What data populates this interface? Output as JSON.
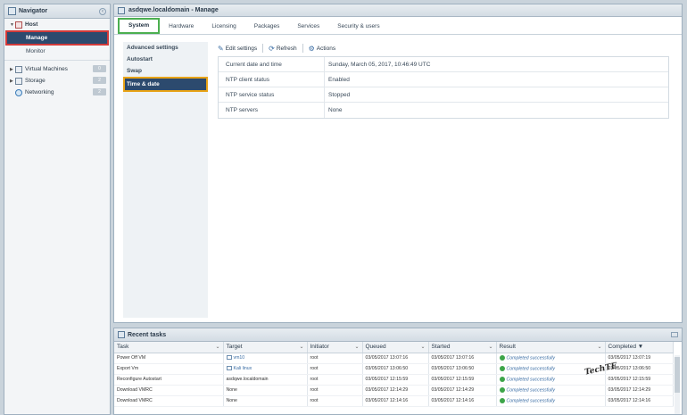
{
  "navigator": {
    "title": "Navigator",
    "host_label": "Host",
    "host_children": [
      "Manage",
      "Monitor"
    ],
    "items": [
      {
        "label": "Virtual Machines",
        "badge": "0"
      },
      {
        "label": "Storage",
        "badge": "2"
      },
      {
        "label": "Networking",
        "badge": "2"
      }
    ]
  },
  "main": {
    "title": "asdqwe.localdomain - Manage",
    "tabs": [
      "System",
      "Hardware",
      "Licensing",
      "Packages",
      "Services",
      "Security & users"
    ],
    "side_menu": [
      "Advanced settings",
      "Autostart",
      "Swap",
      "Time & date"
    ],
    "toolbar": {
      "edit": "Edit settings",
      "refresh": "Refresh",
      "actions": "Actions"
    },
    "properties": [
      {
        "key": "Current date and time",
        "value": "Sunday, March 05, 2017, 10:46:49 UTC"
      },
      {
        "key": "NTP client status",
        "value": "Enabled"
      },
      {
        "key": "NTP service status",
        "value": "Stopped"
      },
      {
        "key": "NTP servers",
        "value": "None"
      }
    ]
  },
  "tasks": {
    "title": "Recent tasks",
    "columns": [
      "Task",
      "Target",
      "Initiator",
      "Queued",
      "Started",
      "Result",
      "Completed ▼"
    ],
    "rows": [
      [
        "Power Off VM",
        "vm10",
        "root",
        "03/05/2017 13:07:16",
        "03/05/2017 13:07:16",
        "Completed successfully",
        "03/05/2017 13:07:19"
      ],
      [
        "Export Vm",
        "Kali linux",
        "root",
        "03/05/2017 13:06:50",
        "03/05/2017 13:06:50",
        "Completed successfully",
        "03/05/2017 13:06:50"
      ],
      [
        "Reconfigure Autostart",
        "asdqwe.localdomain",
        "root",
        "03/05/2017 12:15:59",
        "03/05/2017 12:15:59",
        "Completed successfully",
        "03/05/2017 12:15:59"
      ],
      [
        "Download VMRC",
        "None",
        "root",
        "03/05/2017 12:14:29",
        "03/05/2017 12:14:29",
        "Completed successfully",
        "03/05/2017 12:14:29"
      ],
      [
        "Download VMRC",
        "None",
        "root",
        "03/05/2017 12:14:16",
        "03/05/2017 12:14:16",
        "Completed successfully",
        "03/05/2017 12:14:16"
      ]
    ]
  },
  "watermark": "TechTE",
  "colors": {
    "nav_active_bg": "#2c4a6e",
    "manage_outline": "#d23a3a",
    "tab_outline": "#4caf50",
    "side_outline": "#e8a317",
    "success": "#3da549"
  }
}
